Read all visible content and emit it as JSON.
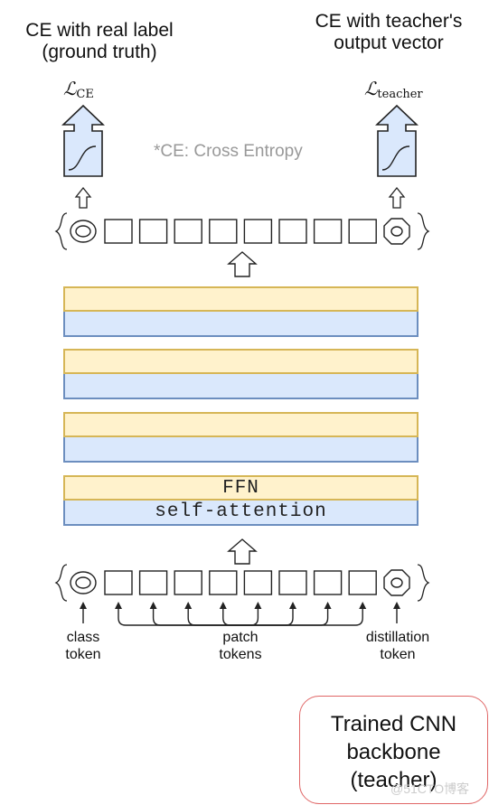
{
  "heads": {
    "left_title_lines": [
      "CE with real label",
      "(ground truth)"
    ],
    "right_title_lines": [
      "CE with teacher's",
      "output vector"
    ],
    "left_loss": {
      "symbol": "ℒ",
      "subscript": "CE"
    },
    "right_loss": {
      "symbol": "ℒ",
      "subscript": "teacher"
    }
  },
  "note": "*CE: Cross Entropy",
  "output_tokens": {
    "patch_count": 8
  },
  "transformer": {
    "blocks": 4,
    "ffn_label": "FFN",
    "attention_label": "self-attention"
  },
  "input_tokens": {
    "patch_count": 8,
    "labels": {
      "class": [
        "class",
        "token"
      ],
      "patch": [
        "patch",
        "tokens"
      ],
      "distillation": [
        "distillation",
        "token"
      ]
    }
  },
  "teacher": {
    "lines": [
      "Trained CNN",
      "backbone",
      "(teacher)"
    ]
  },
  "watermark": "@51CTO博客",
  "colors": {
    "ffn_fill": "#fff2cc",
    "ffn_border": "#d6b656",
    "attention_fill": "#dae8fc",
    "attention_border": "#6c8ebf",
    "head_fill": "#dae8fc",
    "teacher_border": "#e06666",
    "note_text": "#999999"
  }
}
